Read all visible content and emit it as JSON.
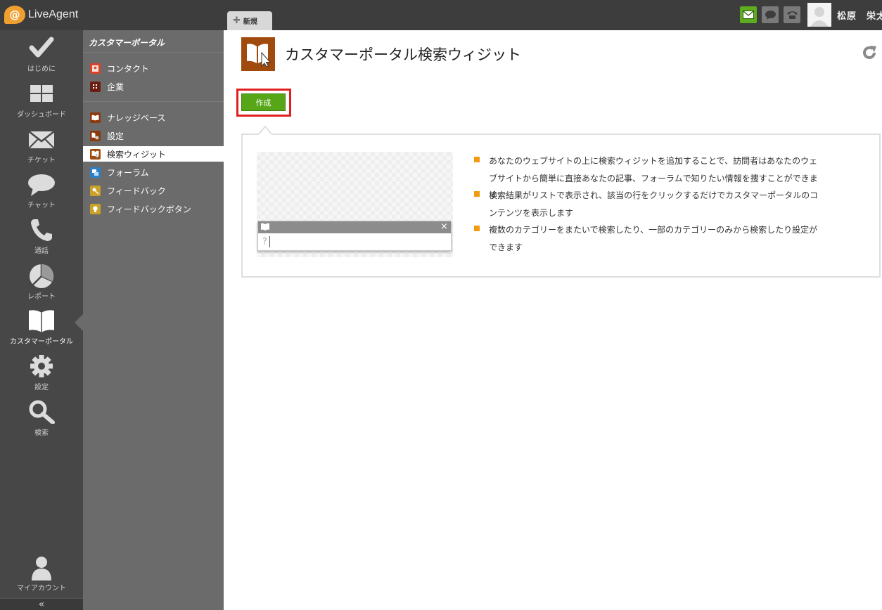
{
  "app": {
    "logo_text": "LiveAgent",
    "logo_symbol": "@",
    "brand_color": "#f0a030"
  },
  "topbar": {
    "new_tab_label": "新規",
    "icons": [
      "mail-icon",
      "chat-bubble-icon",
      "phone-icon"
    ],
    "mail_status_color": "#5dab1e",
    "user_name": "松原　栄太"
  },
  "leftnav": {
    "items": [
      {
        "label": "はじめに",
        "icon": "checkmark-icon"
      },
      {
        "label": "ダッシュボード",
        "icon": "dashboard-grid-icon"
      },
      {
        "label": "チケット",
        "icon": "envelope-icon"
      },
      {
        "label": "チャット",
        "icon": "chat-bubble-icon"
      },
      {
        "label": "通話",
        "icon": "phone-icon"
      },
      {
        "label": "レポート",
        "icon": "pie-chart-icon"
      },
      {
        "label": "カスタマーポータル",
        "icon": "open-book-icon",
        "active": true
      },
      {
        "label": "設定",
        "icon": "gear-icon"
      },
      {
        "label": "検索",
        "icon": "magnifier-icon"
      }
    ],
    "account_label": "マイアカウント",
    "collapse_symbol": "«"
  },
  "subnav": {
    "title": "カスタマーポータル",
    "items": [
      {
        "label": "コンタクト",
        "icon": "contact-card-icon"
      },
      {
        "label": "企業",
        "icon": "building-icon"
      },
      {
        "label": "ナレッジベース",
        "icon": "book-icon"
      },
      {
        "label": "設定",
        "icon": "book-settings-icon"
      },
      {
        "label": "検索ウィジット",
        "icon": "book-search-icon",
        "active": true
      },
      {
        "label": "フォーラム",
        "icon": "forum-icon"
      },
      {
        "label": "フィードバック",
        "icon": "feedback-key-icon"
      },
      {
        "label": "フィードバックボタン",
        "icon": "feedback-bulb-icon"
      }
    ]
  },
  "main": {
    "title": "カスタマーポータル検索ウィジット",
    "create_button": "作成",
    "highlight_color": "#e0201e",
    "widget_preview": {
      "placeholder_symbol": "?",
      "close_symbol": "×"
    },
    "bullets": [
      "あなたのウェブサイトの上に検索ウィジットを追加することで、訪問者はあなたのウェブサイトから簡単に直接あなたの記事、フォーラムで知りたい情報を捜すことができます",
      "検索結果がリストで表示され、該当の行をクリックするだけでカスタマーポータルのコンテンツを表示します",
      "複数のカテゴリーをまたいで検索したり、一部のカテゴリーのみから検索したり設定ができます"
    ],
    "bullet_color": "#f39b10"
  }
}
